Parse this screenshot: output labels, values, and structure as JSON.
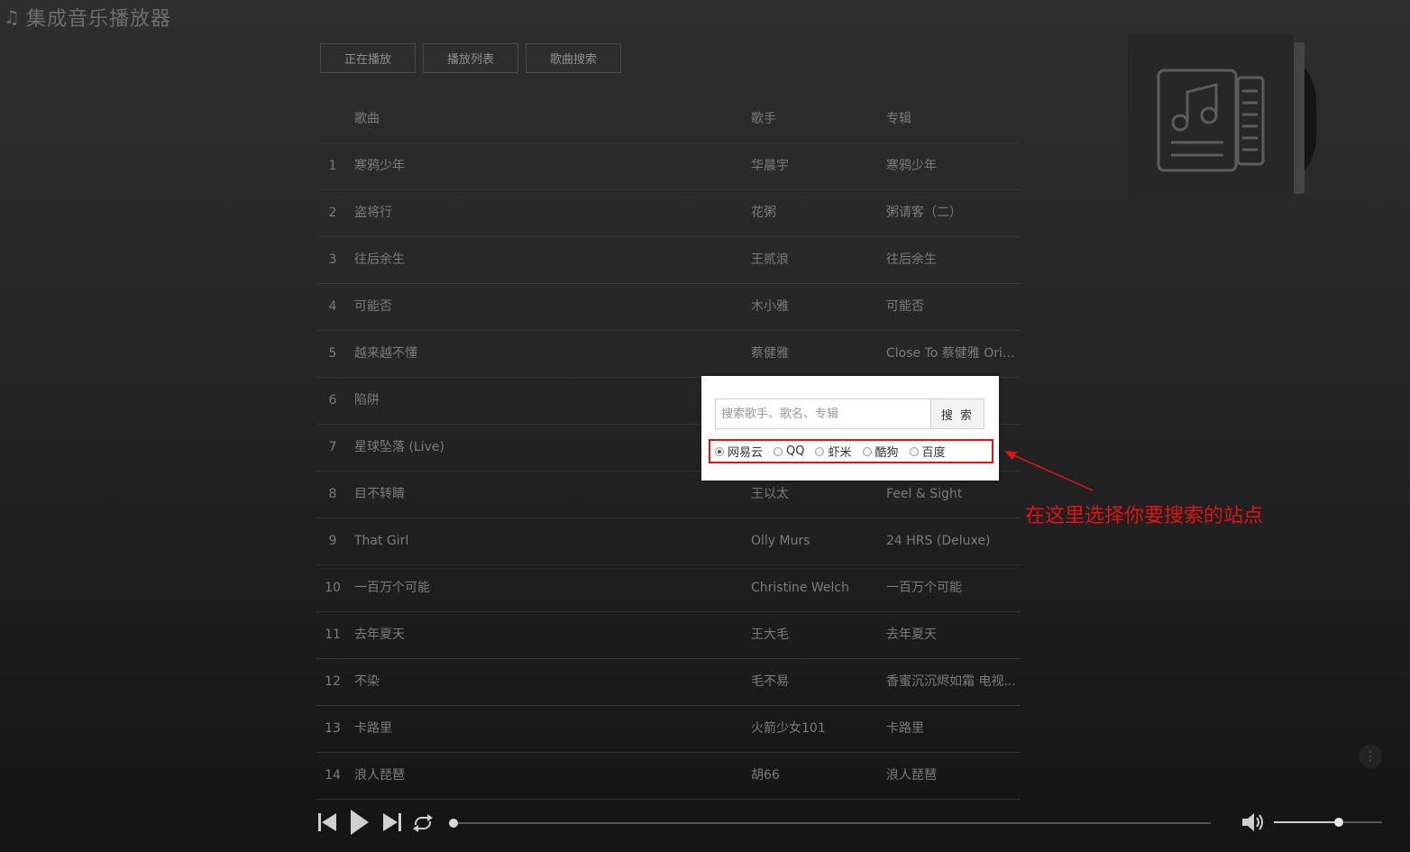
{
  "app": {
    "title": "集成音乐播放器",
    "icon": "music-note-icon"
  },
  "tabs": [
    {
      "label": "正在播放"
    },
    {
      "label": "播放列表"
    },
    {
      "label": "歌曲搜索"
    }
  ],
  "table": {
    "headers": {
      "song": "歌曲",
      "artist": "歌手",
      "album": "专辑"
    },
    "rows": [
      {
        "num": "1",
        "song": "寒鸦少年",
        "artist": "华晨宇",
        "album": "寒鸦少年"
      },
      {
        "num": "2",
        "song": "盗将行",
        "artist": "花粥",
        "album": "粥请客（二）"
      },
      {
        "num": "3",
        "song": "往后余生",
        "artist": "王贰浪",
        "album": "往后余生"
      },
      {
        "num": "4",
        "song": "可能否",
        "artist": "木小雅",
        "album": "可能否"
      },
      {
        "num": "5",
        "song": "越来越不懂",
        "artist": "蔡健雅",
        "album": "Close To 蔡健雅 Origi..."
      },
      {
        "num": "6",
        "song": "陷阱",
        "artist": "",
        "album": ""
      },
      {
        "num": "7",
        "song": "星球坠落 (Live)",
        "artist": "",
        "album": ""
      },
      {
        "num": "8",
        "song": "目不转睛",
        "artist": "王以太",
        "album": "Feel & Sight"
      },
      {
        "num": "9",
        "song": "That Girl",
        "artist": "Olly Murs",
        "album": "24 HRS (Deluxe)"
      },
      {
        "num": "10",
        "song": "一百万个可能",
        "artist": "Christine Welch",
        "album": "一百万个可能"
      },
      {
        "num": "11",
        "song": "去年夏天",
        "artist": "王大毛",
        "album": "去年夏天"
      },
      {
        "num": "12",
        "song": "不染",
        "artist": "毛不易",
        "album": "香蜜沉沉烬如霜 电视..."
      },
      {
        "num": "13",
        "song": "卡路里",
        "artist": "火箭少女101",
        "album": "卡路里"
      },
      {
        "num": "14",
        "song": "浪人琵琶",
        "artist": "胡66",
        "album": "浪人琵琶"
      }
    ]
  },
  "search": {
    "placeholder": "搜索歌手、歌名、专辑",
    "value": "",
    "button_label": "搜 索",
    "sites": [
      {
        "label": "网易云",
        "checked": true
      },
      {
        "label": "QQ",
        "checked": false
      },
      {
        "label": "虾米",
        "checked": false
      },
      {
        "label": "酷狗",
        "checked": false
      },
      {
        "label": "百度",
        "checked": false
      }
    ]
  },
  "annotation": {
    "text": "在这里选择你要搜索的站点",
    "color": "#e01414"
  },
  "player": {
    "progress": 0.0,
    "volume": 0.6,
    "icons": [
      "previous-icon",
      "play-icon",
      "next-icon",
      "repeat-icon",
      "volume-icon"
    ]
  },
  "colors": {
    "background": "#262626",
    "highlight_border": "#e0141e",
    "annotation": "#e01414"
  }
}
